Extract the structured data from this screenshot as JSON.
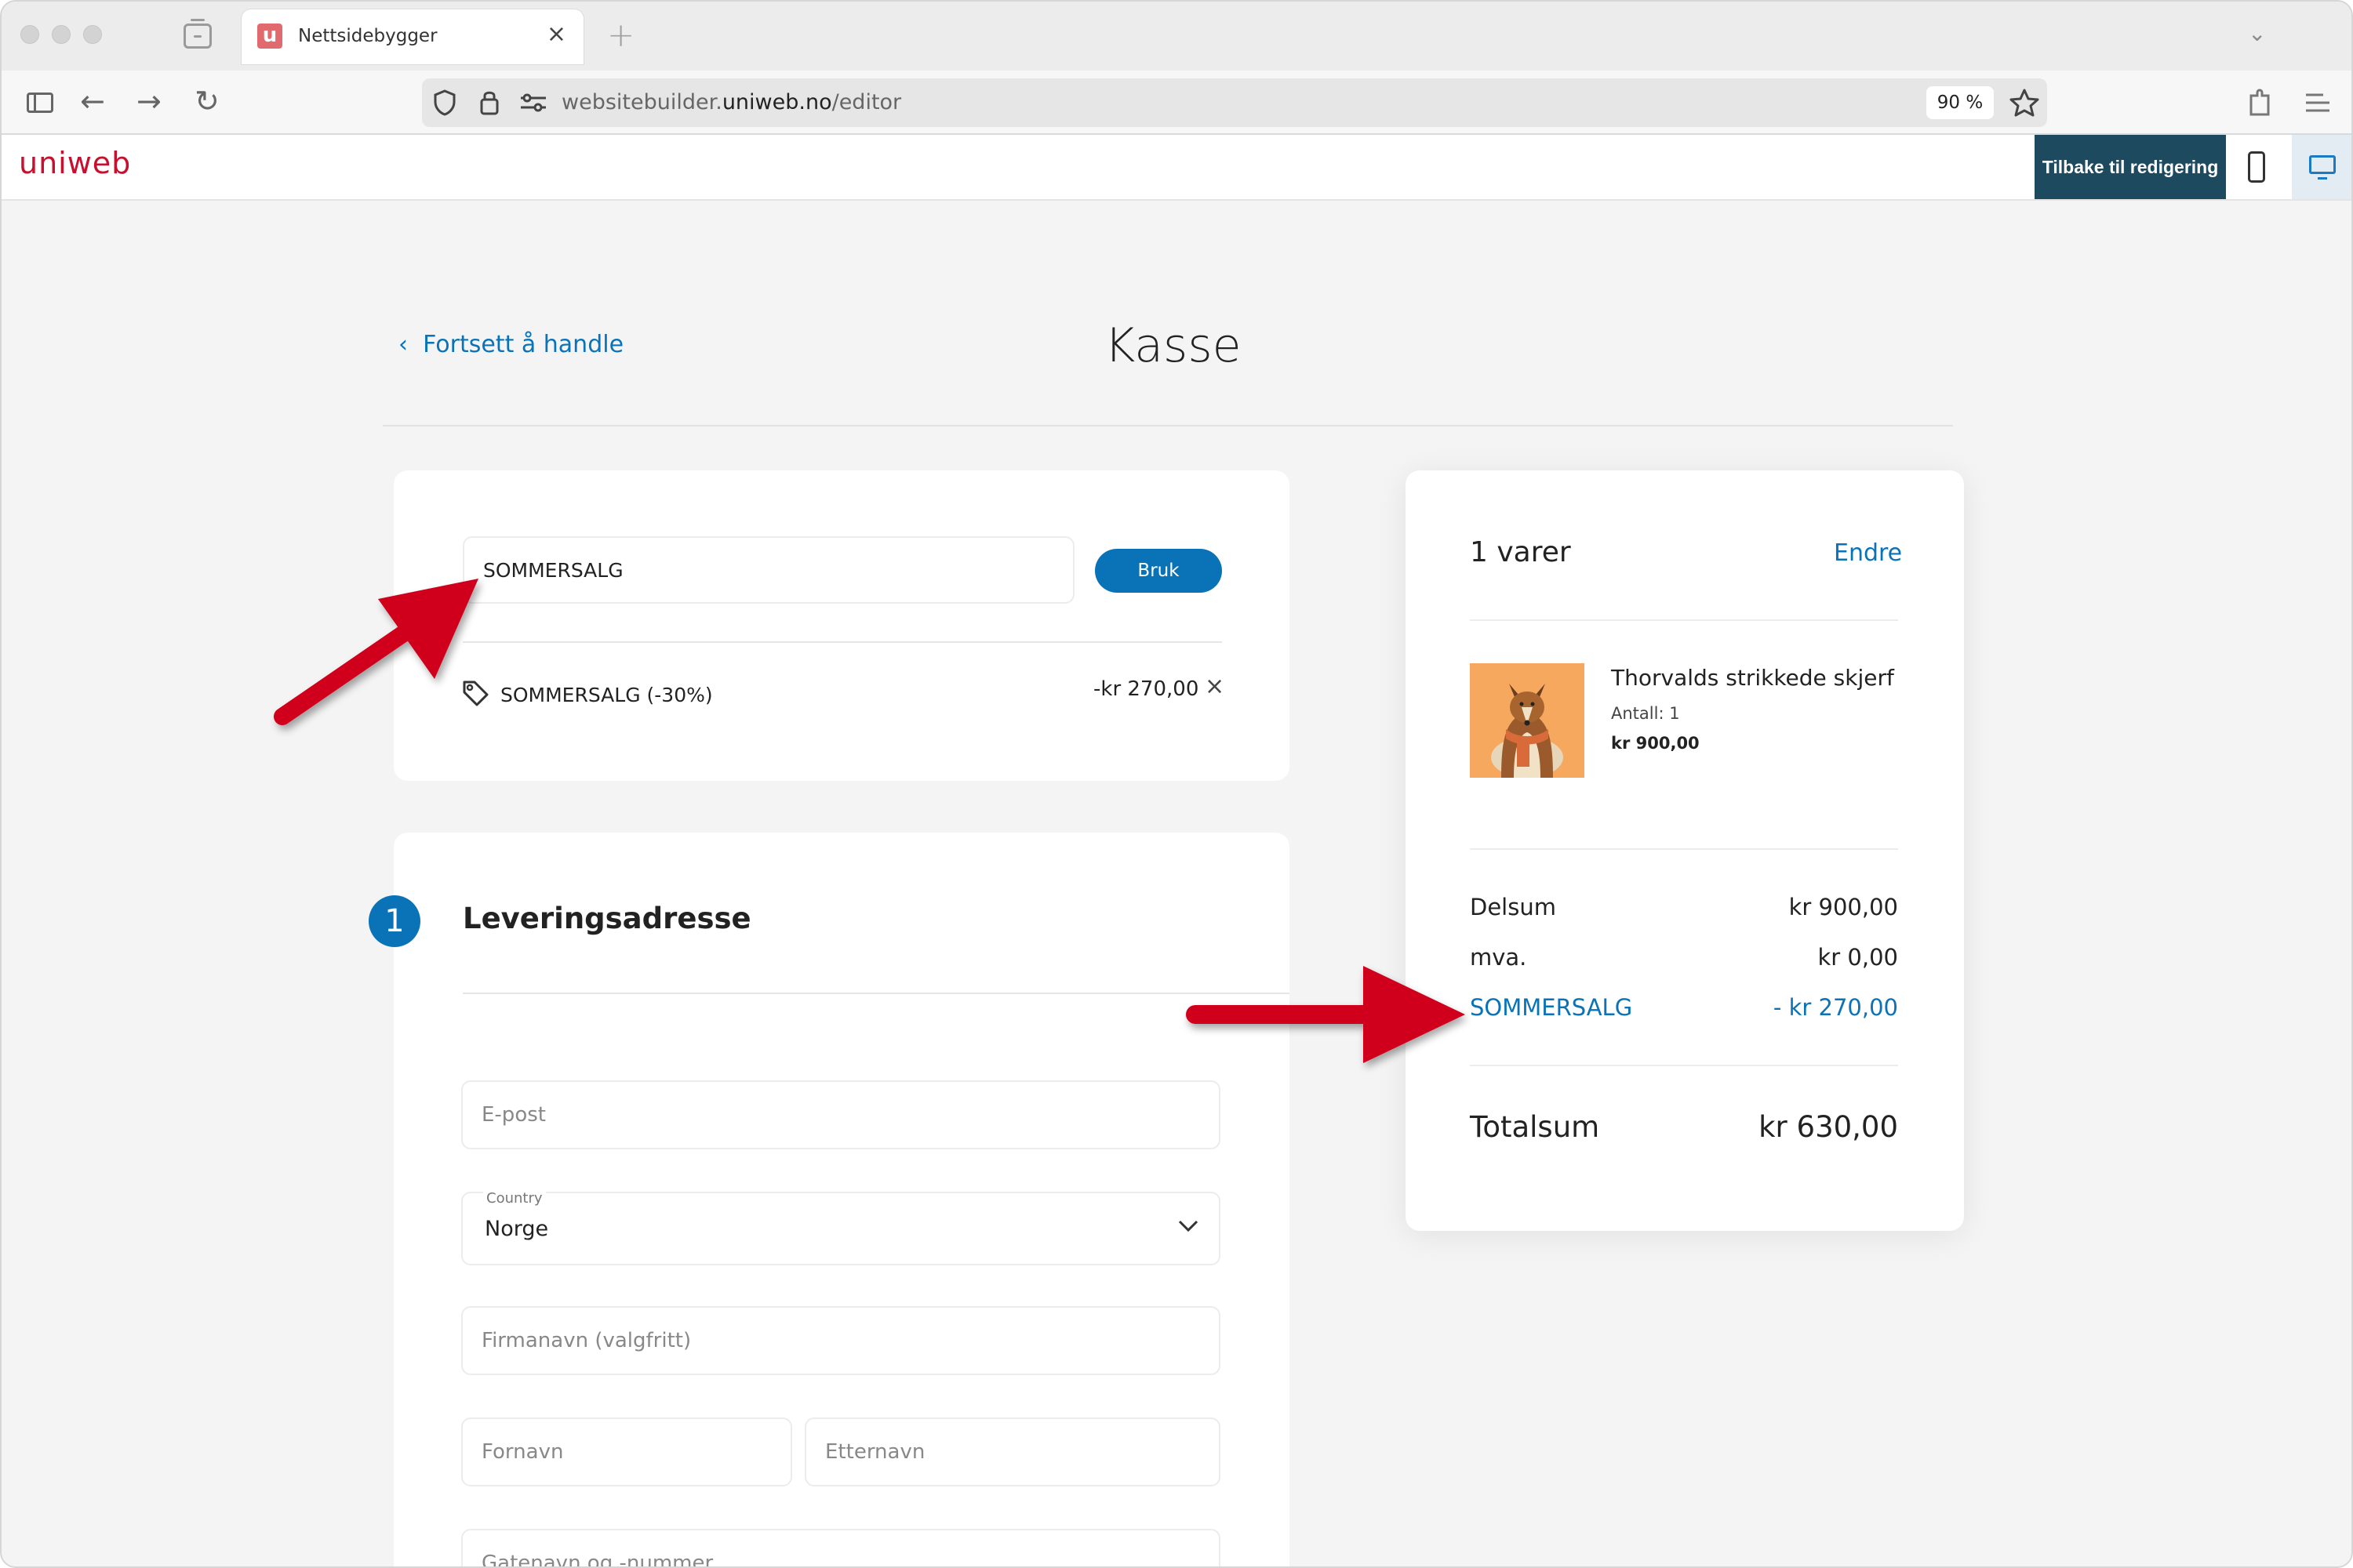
{
  "browser": {
    "tab_title": "Nettsidebygger",
    "favicon_letter": "u",
    "url_host_prefix": "websitebuilder.",
    "url_host_main": "uniweb.no",
    "url_path": "/editor",
    "zoom": "90 %"
  },
  "app_header": {
    "logo": "uniweb",
    "back_to_editing": "Tilbake til redigering"
  },
  "page": {
    "continue_shopping": "Fortsett å handle",
    "title": "Kasse"
  },
  "coupon": {
    "input_value": "SOMMERSALG",
    "apply_label": "Bruk",
    "applied_label": "SOMMERSALG (-30%)",
    "applied_amount": "-kr 270,00",
    "remove_icon": "×"
  },
  "delivery": {
    "step_number": "1",
    "title": "Leveringsadresse",
    "email_placeholder": "E-post",
    "country_label": "Country",
    "country_value": "Norge",
    "company_placeholder": "Firmanavn (valgfritt)",
    "first_name_placeholder": "Fornavn",
    "last_name_placeholder": "Etternavn",
    "street_placeholder": "Gatenavn og -nummer"
  },
  "summary": {
    "items_count": "1 varer",
    "edit_label": "Endre",
    "product": {
      "name": "Thorvalds strikkede skjerf",
      "quantity": "Antall: 1",
      "price": "kr 900,00"
    },
    "rows": [
      {
        "label": "Delsum",
        "value": "kr 900,00"
      },
      {
        "label": "mva.",
        "value": "kr 0,00"
      },
      {
        "label": "SOMMERSALG",
        "value": "- kr 270,00"
      }
    ],
    "total_label": "Totalsum",
    "total_value": "kr 630,00"
  },
  "colors": {
    "accent": "#0a73b8",
    "brand": "#c8102e",
    "header_button": "#1e4a60",
    "annotation_arrow": "#d0021b"
  }
}
